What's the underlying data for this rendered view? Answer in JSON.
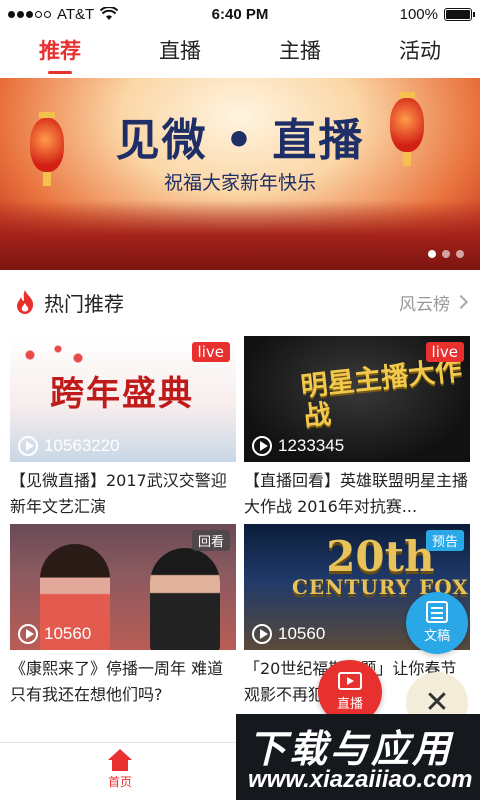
{
  "status_bar": {
    "carrier": "AT&T",
    "time": "6:40 PM",
    "battery": "100%"
  },
  "top_tabs": [
    {
      "label": "推荐",
      "active": true
    },
    {
      "label": "直播",
      "active": false
    },
    {
      "label": "主播",
      "active": false
    },
    {
      "label": "活动",
      "active": false
    }
  ],
  "banner": {
    "title": "见微 • 直播",
    "subtitle": "祝福大家新年快乐",
    "slide_count": 3,
    "active_slide": 1
  },
  "section": {
    "title": "热门推荐",
    "more_label": "风云榜",
    "icon": "fire-icon"
  },
  "cards": [
    {
      "badge": "live",
      "thumb_text": "跨年盛典",
      "views": "10563220",
      "title": "【见微直播】2017武汉交警迎新年文艺汇演"
    },
    {
      "badge": "live",
      "thumb_text": "明星主播大作战",
      "views": "1233345",
      "title": "【直播回看】英雄联盟明星主播大作战 2016年对抗赛..."
    },
    {
      "badge": "回看",
      "views": "10560",
      "title": "《康熙来了》停播一周年 难道只有我还在想他们吗?"
    },
    {
      "badge": "预告",
      "thumb_text_number": "20th",
      "thumb_text_words": "CENTURY FOX",
      "views": "10560",
      "title": "「20世纪福斯专题」让你春节观影不再犯头绪"
    }
  ],
  "floating": {
    "doc_label": "文稿",
    "live_label": "直播",
    "close_symbol": "✕"
  },
  "bottom_nav": {
    "home_label": "首页"
  },
  "watermark": {
    "title": "下载与应用",
    "url": "www.xiazaiiiao.com"
  },
  "colors": {
    "accent": "#e8312f",
    "blue": "#2aa7e6"
  }
}
